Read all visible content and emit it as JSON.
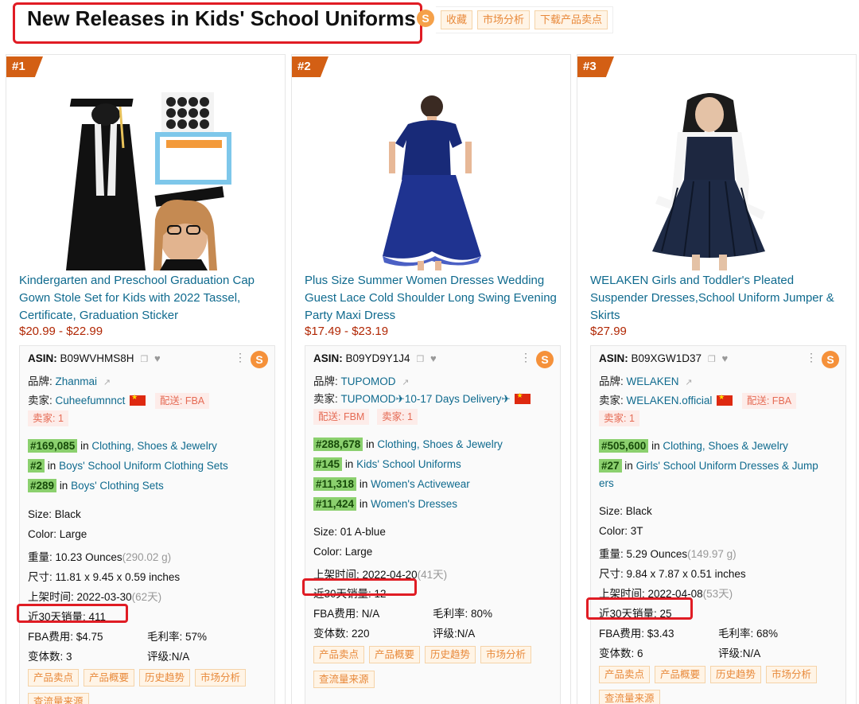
{
  "header": {
    "title": "New Releases in Kids' School Uniforms",
    "seller_logo_char": "S",
    "tools": [
      "收藏",
      "市场分析",
      "下载产品卖点"
    ]
  },
  "labels": {
    "asin": "ASIN:",
    "brand": "品牌:",
    "seller": "卖家:",
    "in": "in",
    "size": "Size:",
    "color": "Color:",
    "weight": "重量:",
    "dims": "尺寸:",
    "listed": "上架时间:",
    "sales30": "近30天销量:",
    "fba": "FBA费用:",
    "margin": "毛利率:",
    "variants": "变体数:",
    "rating": "评级:",
    "more_ops": "⋮",
    "s_logo": "S"
  },
  "products": [
    {
      "rank": "#1",
      "title": "Kindergarten and Preschool Graduation Cap Gown Stole Set for Kids with 2022 Tassel, Certificate, Graduation Sticker",
      "price": "$20.99 - $22.99",
      "asin": "B09WVHMS8H",
      "brand": "Zhanmai",
      "seller": "Cuheefumnnct",
      "ship": "配送: FBA",
      "sellers_count": "卖家: 1",
      "ranks": [
        {
          "rank": "#169,085",
          "category": "Clothing, Shoes & Jewelry"
        },
        {
          "rank": "#2",
          "category": "Boys' School Uniform Clothing Sets"
        },
        {
          "rank": "#289",
          "category": "Boys' Clothing Sets"
        }
      ],
      "size": "Black",
      "color": "Large",
      "weight": "10.23 Ounces",
      "weight_g": "(290.02 g)",
      "dims": "11.81 x 9.45 x 0.59 inches",
      "listed": "2022-03-30",
      "listed_days": "(62天)",
      "sales30": "411",
      "fba": "$4.75",
      "margin": "57%",
      "variants": "3",
      "rating": "N/A",
      "buttons": [
        "产品卖点",
        "产品概要",
        "历史趋势",
        "市场分析"
      ],
      "button2": "查流量来源"
    },
    {
      "rank": "#2",
      "title": "Plus Size Summer Women Dresses Wedding Guest Lace Cold Shoulder Long Swing Evening Party Maxi Dress",
      "price": "$17.49 - $23.19",
      "asin": "B09YD9Y1J4",
      "brand": "TUPOMOD",
      "seller": "TUPOMOD✈10-17 Days Delivery✈",
      "ship": "配送: FBM",
      "sellers_count": "卖家: 1",
      "ranks": [
        {
          "rank": "#288,678",
          "category": "Clothing, Shoes & Jewelry"
        },
        {
          "rank": "#145",
          "category": "Kids' School Uniforms"
        },
        {
          "rank": "#11,318",
          "category": "Women's Activewear"
        },
        {
          "rank": "#11,424",
          "category": "Women's Dresses"
        }
      ],
      "size": "01 A-blue",
      "color": "Large",
      "listed": "2022-04-20",
      "listed_days": "(41天)",
      "sales30": "12",
      "fba": "N/A",
      "margin": "80%",
      "variants": "220",
      "rating": "N/A",
      "buttons": [
        "产品卖点",
        "产品概要",
        "历史趋势",
        "市场分析"
      ],
      "button2": "查流量来源"
    },
    {
      "rank": "#3",
      "title": "WELAKEN Girls and Toddler's Pleated Suspender Dresses,School Uniform Jumper & Skirts",
      "price": "$27.99",
      "asin": "B09XGW1D37",
      "brand": "WELAKEN",
      "seller": "WELAKEN.official",
      "ship": "配送: FBA",
      "sellers_count": "卖家: 1",
      "ranks": [
        {
          "rank": "#505,600",
          "category": "Clothing, Shoes & Jewelry"
        },
        {
          "rank": "#27",
          "category": "Girls' School Uniform Dresses & Jump",
          "category_cont": "ers"
        }
      ],
      "size": "Black",
      "color": "3T",
      "weight": "5.29 Ounces",
      "weight_g": "(149.97 g)",
      "dims": "9.84 x 7.87 x 0.51 inches",
      "listed": "2022-04-08",
      "listed_days": "(53天)",
      "sales30": "25",
      "fba": "$3.43",
      "margin": "68%",
      "variants": "6",
      "rating": "N/A",
      "buttons": [
        "产品卖点",
        "产品概要",
        "历史趋势",
        "市场分析"
      ],
      "button2": "查流量来源"
    }
  ]
}
